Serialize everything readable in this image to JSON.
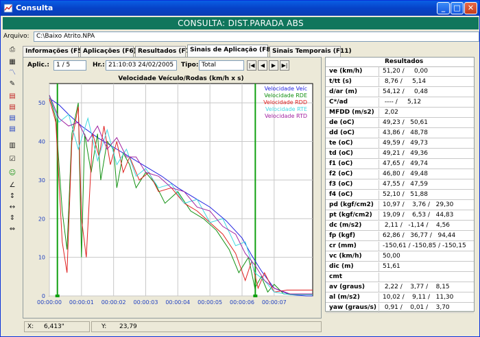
{
  "window": {
    "title": "Consulta",
    "minimize": "_",
    "maximize": "□",
    "close": "✕"
  },
  "banner": "CONSULTA: DIST.PARADA ABS",
  "file": {
    "label": "Arquivo:",
    "value": "C:\\Baixo Atrito.NPA"
  },
  "tabs": [
    {
      "label": "Informações (F5)",
      "active": false
    },
    {
      "label": "Aplicações (F6)",
      "active": false
    },
    {
      "label": "Resultados (F7)",
      "active": false
    },
    {
      "label": "Sinais de Aplicação (F8)",
      "active": true
    },
    {
      "label": "Sinais Temporais (F11)",
      "active": false
    }
  ],
  "controls": {
    "aplic_label": "Aplic.:",
    "aplic_value": "1 / 5",
    "hr_label": "Hr.:",
    "hr_value": "21:10:03 24/02/2005",
    "tipo_label": "Tipo:",
    "tipo_value": "Total",
    "nav": [
      "|◀",
      "◀",
      "▶",
      "▶|"
    ]
  },
  "toolbar_icons": [
    "print-icon",
    "calc-icon",
    "chart-icon",
    "edit-icon",
    "doc-red-icon",
    "doc-red-icon",
    "doc-blue-icon",
    "doc-blue-icon",
    "chart-bars-icon",
    "checkbox-icon",
    "smiley-icon",
    "angle-icon",
    "vertical-arrows-icon",
    "horizontal-arrows-icon",
    "expand-vertical-icon",
    "expand-horizontal-icon"
  ],
  "chart_data": {
    "type": "line",
    "title": "Velocidade Veículo/Rodas (km/h x s)",
    "xlabel": "",
    "ylabel": "",
    "ylim": [
      0,
      55
    ],
    "yticks": [
      0,
      10,
      20,
      30,
      40,
      50
    ],
    "xticks": [
      "00:00:00",
      "00:00:01",
      "00:00:02",
      "00:00:03",
      "00:00:04",
      "00:00:05",
      "00:00:06",
      "00:00:07"
    ],
    "xlim": [
      0,
      8.2
    ],
    "markers": [
      0.25,
      6.413
    ],
    "series": [
      {
        "name": "Velocidade Veíc",
        "color": "#2020e0",
        "x": [
          0,
          0.3,
          0.6,
          1.0,
          1.5,
          2.0,
          2.5,
          3.0,
          3.5,
          4.0,
          4.5,
          5.0,
          5.5,
          6.0,
          6.3,
          6.6,
          7.0,
          7.5,
          8.0,
          8.2
        ],
        "y": [
          51.2,
          49.5,
          47,
          44,
          41,
          38.5,
          36,
          33.5,
          31,
          28,
          25.5,
          23,
          19.5,
          15,
          10.5,
          6.5,
          2,
          0.3,
          0,
          0
        ]
      },
      {
        "name": "Velocidade RDE",
        "color": "#109010",
        "x": [
          0,
          0.2,
          0.4,
          0.55,
          0.7,
          0.9,
          1.0,
          1.1,
          1.3,
          1.5,
          1.6,
          1.8,
          2.0,
          2.1,
          2.3,
          2.5,
          2.7,
          3.0,
          3.3,
          3.6,
          4.0,
          4.4,
          4.8,
          5.2,
          5.6,
          5.9,
          6.2,
          6.4,
          6.6,
          6.8,
          7.0,
          7.3,
          7.8,
          8.2
        ],
        "y": [
          52,
          46,
          22,
          12,
          42,
          50,
          10,
          42,
          32,
          42,
          30,
          40,
          38,
          28,
          37,
          34,
          28,
          32,
          29,
          24,
          27,
          22,
          20,
          17,
          12,
          6,
          10,
          2,
          5,
          1,
          3,
          0.5,
          0.4,
          0.4
        ]
      },
      {
        "name": "Velocidade RDD",
        "color": "#e02020",
        "x": [
          0,
          0.2,
          0.4,
          0.55,
          0.7,
          0.9,
          1.0,
          1.15,
          1.35,
          1.55,
          1.7,
          1.9,
          2.1,
          2.3,
          2.5,
          2.8,
          3.1,
          3.4,
          3.8,
          4.2,
          4.6,
          5.0,
          5.4,
          5.8,
          6.1,
          6.3,
          6.5,
          6.7,
          7.0,
          7.4,
          7.8,
          8.2
        ],
        "y": [
          51,
          45,
          14,
          6,
          40,
          49,
          20,
          10,
          42,
          36,
          44,
          34,
          40,
          32,
          36,
          30,
          32,
          27,
          28,
          24,
          22,
          19,
          16,
          11,
          4,
          9,
          2,
          6,
          1,
          1.5,
          1.5,
          1.5
        ]
      },
      {
        "name": "Velocidade RTE",
        "color": "#40d8e0",
        "x": [
          0,
          0.3,
          0.6,
          0.9,
          1.2,
          1.5,
          1.8,
          2.1,
          2.4,
          2.7,
          3.0,
          3.4,
          3.8,
          4.2,
          4.6,
          5.0,
          5.4,
          5.8,
          6.1,
          6.4,
          6.7,
          7.0,
          7.5,
          8.2
        ],
        "y": [
          52,
          45,
          47,
          38,
          46,
          35,
          43,
          34,
          38,
          31,
          33,
          28,
          29,
          24,
          25,
          19,
          20,
          13,
          14,
          6,
          4,
          1,
          0.3,
          0.3
        ]
      },
      {
        "name": "Velocidade RTD",
        "color": "#a020a0",
        "x": [
          0,
          0.3,
          0.6,
          0.9,
          1.2,
          1.5,
          1.8,
          2.1,
          2.4,
          2.7,
          3.0,
          3.4,
          3.8,
          4.2,
          4.6,
          5.0,
          5.4,
          5.8,
          6.1,
          6.4,
          6.7,
          7.0,
          7.5,
          8.2
        ],
        "y": [
          52,
          46,
          44,
          45,
          40,
          44,
          38,
          41,
          36,
          36,
          32,
          31,
          28,
          27,
          23,
          22,
          18,
          16,
          11,
          8,
          4,
          2,
          0.5,
          0.5
        ]
      }
    ]
  },
  "status": {
    "x_label": "X:",
    "x_value": "6,413\"",
    "y_label": "Y:",
    "y_value": "23,79"
  },
  "results": {
    "header": "Resultados",
    "rows": [
      {
        "label": "ve   (km/h)",
        "value": "51,20 /     0,00"
      },
      {
        "label": "t/tt  (s)",
        "value": " 8,76 /     5,14"
      },
      {
        "label": "d/ar  (m)",
        "value": "54,12 /     0,48"
      },
      {
        "label": "C*/ad",
        "value": " ---- /     5,12"
      },
      {
        "label": "MFDD   (m/s2)",
        "value": " 2,02"
      },
      {
        "label": "de   (oC)",
        "value": "49,23 /   50,61"
      },
      {
        "label": "dd   (oC)",
        "value": "43,86 /   48,78"
      },
      {
        "label": "te   (oC)",
        "value": "49,59 /   49,73"
      },
      {
        "label": "td   (oC)",
        "value": "49,21 /   49,36"
      },
      {
        "label": "f1   (oC)",
        "value": "47,65 /   49,74"
      },
      {
        "label": "f2   (oC)",
        "value": "46,80 /   49,48"
      },
      {
        "label": "f3   (oC)",
        "value": "47,55 /   47,59"
      },
      {
        "label": "f4   (oC)",
        "value": "52,10 /   51,88"
      },
      {
        "label": "pd   (kgf/cm2)",
        "value": "10,97 /    3,76 /   29,30"
      },
      {
        "label": "pt   (kgf/cm2)",
        "value": "19,09 /    6,53 /   44,83"
      },
      {
        "label": "dc   (m/s2)",
        "value": " 2,11 /   -1,14 /    4,56"
      },
      {
        "label": "fp   (kgf)",
        "value": "62,86 /   36,77 /   94,44"
      },
      {
        "label": "cr   (mm)",
        "value": "-150,61 / -150,85 / -150,15"
      },
      {
        "label": "vc   (km/h)",
        "value": "50,00"
      },
      {
        "label": "dic  (m)",
        "value": "51,61"
      },
      {
        "label": "cmt",
        "value": ""
      },
      {
        "label": "av   (graus)",
        "value": " 2,22 /    3,77 /    8,15"
      },
      {
        "label": "al   (m/s2)",
        "value": "10,02 /    9,11 /   11,30"
      },
      {
        "label": "yaw  (graus/s)",
        "value": " 0,91 /    0,01 /    3,70"
      }
    ]
  }
}
